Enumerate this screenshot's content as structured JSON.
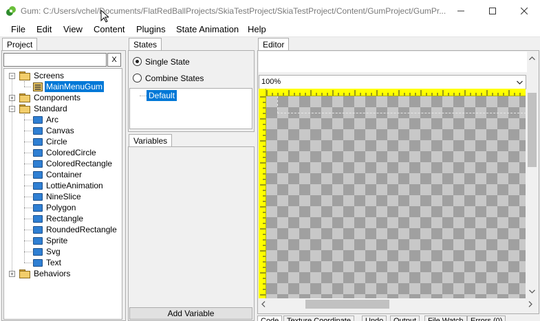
{
  "window": {
    "title": "Gum: C:/Users/vchel/Documents/FlatRedBallProjects/SkiaTestProject/SkiaTestProject/Content/GumProject/GumPr...",
    "minimize_icon": "minimize-icon",
    "maximize_icon": "maximize-icon",
    "close_icon": "close-icon"
  },
  "menu": [
    "File",
    "Edit",
    "View",
    "Content",
    "Plugins",
    "State Animation",
    "Help"
  ],
  "project": {
    "tab": "Project",
    "search_value": "",
    "clear_label": "X",
    "tree": {
      "screens": "Screens",
      "main_menu": "MainMenuGum",
      "components": "Components",
      "standard": "Standard",
      "standard_items": [
        "Arc",
        "Canvas",
        "Circle",
        "ColoredCircle",
        "ColoredRectangle",
        "Container",
        "LottieAnimation",
        "NineSlice",
        "Polygon",
        "Rectangle",
        "RoundedRectangle",
        "Sprite",
        "Svg",
        "Text"
      ],
      "behaviors": "Behaviors"
    }
  },
  "states": {
    "tab": "States",
    "single_state": "Single State",
    "combine_states": "Combine States",
    "default_state": "Default"
  },
  "variables": {
    "tab": "Variables",
    "add_variable": "Add Variable"
  },
  "editor": {
    "tab": "Editor",
    "zoom": "100%",
    "bottom_tabs": [
      "Code",
      "Texture Coordinate",
      "Undo",
      "Output",
      "File Watch",
      "Errors (0)"
    ]
  },
  "colors": {
    "selection": "#0078d7",
    "ruler": "#ffff00"
  }
}
